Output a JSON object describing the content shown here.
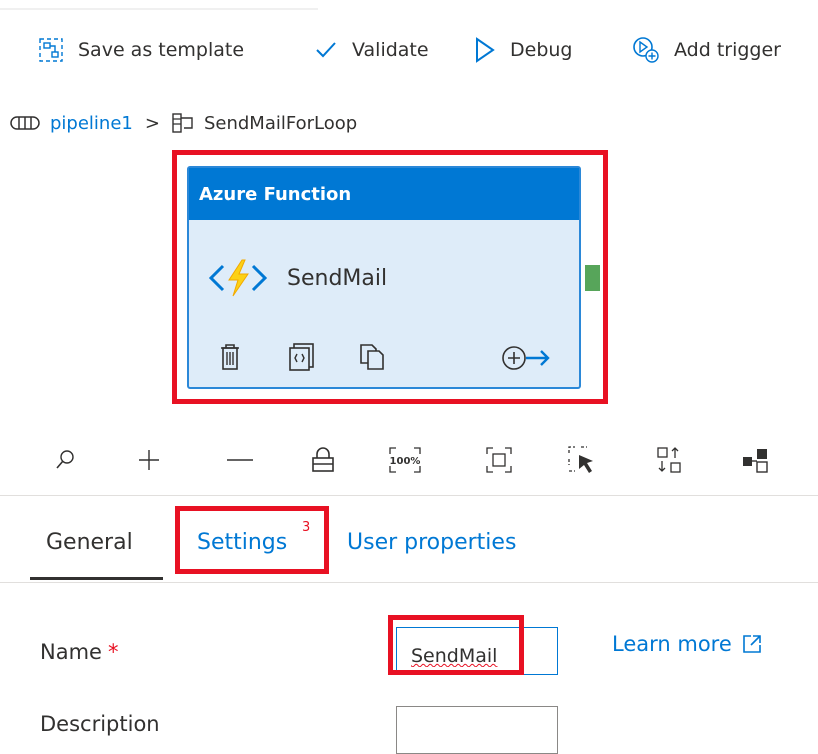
{
  "toolbar": {
    "save_template": "Save as template",
    "validate": "Validate",
    "debug": "Debug",
    "add_trigger": "Add trigger"
  },
  "breadcrumb": {
    "pipeline": "pipeline1",
    "separator": ">",
    "activity": "SendMailForLoop"
  },
  "activity_card": {
    "type": "Azure Function",
    "name": "SendMail",
    "actions": [
      "delete-icon",
      "code-icon",
      "copy-icon",
      "add-output-icon"
    ]
  },
  "canvas_tools": [
    "search-icon",
    "zoom-in-icon",
    "zoom-out-icon",
    "lock-icon",
    "zoom-100-icon",
    "fit-to-screen-icon",
    "select-icon",
    "auto-align-icon",
    "layout-icon"
  ],
  "tabs": {
    "general": "General",
    "settings": "Settings",
    "settings_badge": "3",
    "user_properties": "User properties"
  },
  "form": {
    "name_label": "Name",
    "required_marker": "*",
    "name_value": "SendMail",
    "description_label": "Description",
    "description_value": "",
    "learn_more": "Learn more"
  },
  "colors": {
    "accent": "#0078d4",
    "highlight": "#e81123",
    "card_bg": "#deecf9",
    "success_port": "#57a55a"
  }
}
